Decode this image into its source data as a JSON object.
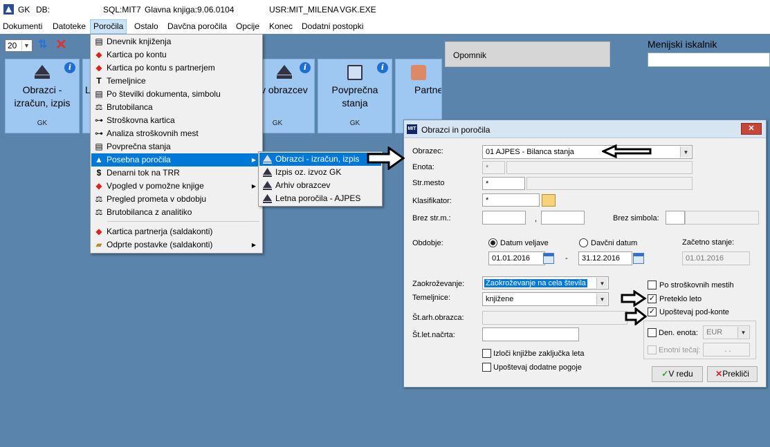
{
  "titlebar": {
    "app": "GK",
    "db": "DB:",
    "sql": "SQL:MIT7",
    "ledger": "Glavna knjiga:9.06.0104",
    "user": "USR:MIT_MILENA",
    "exe": "VGK.EXE"
  },
  "menubar": [
    "Dokumenti",
    "Datoteke",
    "Poročila",
    "Ostalo",
    "Davčna poročila",
    "Opcije",
    "Konec",
    "Dodatni postopki"
  ],
  "toolbar": {
    "page_size": "20"
  },
  "tiles": [
    {
      "title": "Obrazci - izračun, izpis",
      "code": "GK"
    },
    {
      "title": "L",
      "code": ""
    },
    {
      "title": "v obrazcev",
      "code": "GK"
    },
    {
      "title": "Povprečna stanja",
      "code": "GK"
    },
    {
      "title": "Partne",
      "code": ""
    }
  ],
  "opomnik": "Opomnik",
  "search": {
    "label": "Menijski iskalnik"
  },
  "dropdown": [
    {
      "label": "Dnevnik knjiženja",
      "icon": "list-icon"
    },
    {
      "label": "Kartica po kontu",
      "icon": "card-icon"
    },
    {
      "label": "Kartica po kontu s partnerjem",
      "icon": "card-icon"
    },
    {
      "label": "Temeljnice",
      "icon": "text-icon"
    },
    {
      "label": "Po številki dokumenta, simbolu",
      "icon": "list-icon"
    },
    {
      "label": "Brutobilanca",
      "icon": "scale-icon"
    },
    {
      "label": "Stroškovna kartica",
      "icon": "tree-icon"
    },
    {
      "label": "Analiza stroškovnih mest",
      "icon": "tree-icon"
    },
    {
      "label": "Povprečna stanja",
      "icon": "list-icon"
    },
    {
      "label": "Posebna poročila",
      "icon": "duns-icon"
    },
    {
      "label": "Denarni tok na TRR",
      "icon": "dollar-icon"
    },
    {
      "label": "Vpogled v pomožne knjige",
      "icon": "card-icon"
    },
    {
      "label": "Pregled prometa v obdobju",
      "icon": "scale-icon"
    },
    {
      "label": "Brutobilanca z analitiko",
      "icon": "scale-icon"
    },
    {
      "label": "Kartica partnerja (saldakonti)",
      "icon": "card-icon"
    },
    {
      "label": "Odprte postavke (saldakonti)",
      "icon": "folder-icon"
    }
  ],
  "submenu": [
    "Obrazci - izračun, izpis",
    "Izpis oz. izvoz GK",
    "Arhiv obrazcev",
    "Letna poročila - AJPES"
  ],
  "dialog": {
    "title": "Obrazci in poročila",
    "close": "✕",
    "obrazec_label": "Obrazec:",
    "obrazec_value": "01  AJPES - Bilanca stanja",
    "enota_label": "Enota:",
    "enota_value": "*",
    "strmesto_label": "Str.mesto",
    "strmesto_value": "*",
    "klasifikator_label": "Klasifikator:",
    "klasifikator_value": "*",
    "brezstrm_label": "Brez str.m.:",
    "brezstrm_sep": ",",
    "brezsimbola_label": "Brez simbola:",
    "obdobje_label": "Obdobje:",
    "datum_veljave": "Datum veljave",
    "davcni_datum": "Davčni datum",
    "zacetno_stanje_label": "Začetno stanje:",
    "date_from": "01.01.2016",
    "date_sep": "-",
    "date_to": "31.12.2016",
    "zacetno_stanje_value": "01.01.2016",
    "zaokrozevanje_label": "Zaokroževanje:",
    "zaokrozevanje_value": "Zaokroževanje na cela števila",
    "temeljnice_label": "Temeljnice:",
    "temeljnice_value": "knjižene",
    "starh_label": "Št.arh.obrazca:",
    "stlet_label": "Št.let.načrta:",
    "izloci": "Izloči knjižbe zaključka leta",
    "upostevaj_pogoje": "Upoštevaj dodatne pogoje",
    "po_stroskovnih": "Po stroškovnih mestih",
    "preteklo_leto": "Preteklo leto",
    "upostevaj_podkonte": "Upoštevaj pod-konte",
    "den_enota": "Den. enota:",
    "den_enota_value": "EUR",
    "enotni_tecaj": "Enotni tečaj:",
    "enotni_tecaj_value": ". .",
    "ok": "V redu",
    "cancel": "Prekliči"
  }
}
